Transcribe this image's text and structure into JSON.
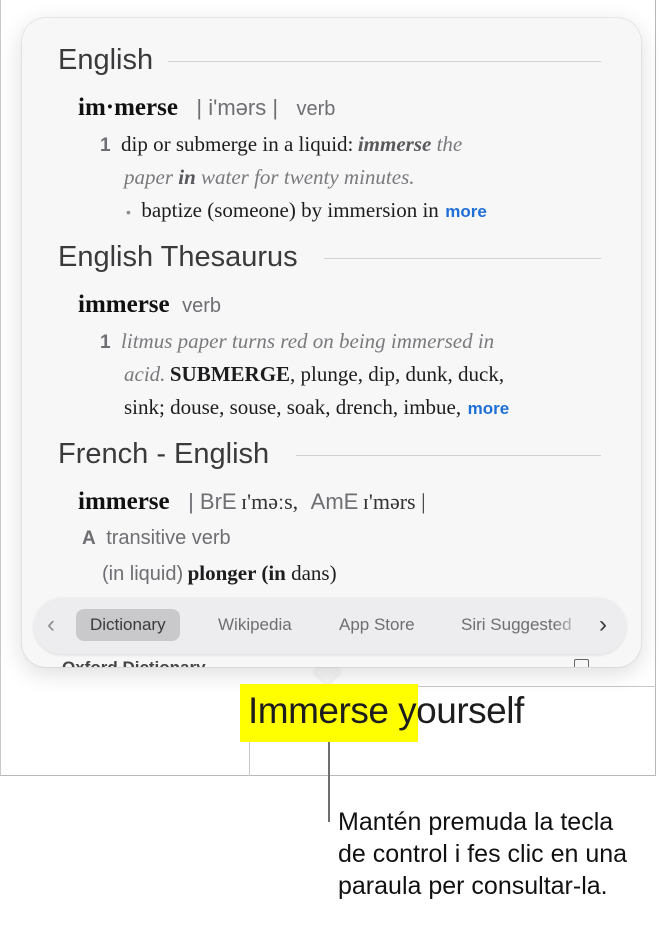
{
  "popover": {
    "sections": [
      {
        "title": "English",
        "headword": "im·merse",
        "pronunciation": "| i'mərs |",
        "part_of_speech": "verb",
        "sense_number": "1",
        "definition": "dip or submerge in a liquid:",
        "example_1a": "immerse",
        "example_1b": " the",
        "example_2a": "paper ",
        "example_2b": "in",
        "example_2c": " water for twenty minutes.",
        "subsense": "baptize (someone) by immersion in",
        "more": "more"
      },
      {
        "title": "English Thesaurus",
        "headword": "immerse",
        "part_of_speech": "verb",
        "sense_number": "1",
        "example_line1": "litmus paper turns red on being immersed in",
        "example_line2": "acid.",
        "synonym_main": "SUBMERGE",
        "synonyms_line1": ", plunge, dip, dunk, duck,",
        "synonyms_line2": "sink; douse, souse, soak, drench, imbue,",
        "more": "more"
      },
      {
        "title": "French - English",
        "headword": "immerse",
        "pron_bre_label": "| BrE",
        "pron_bre": "ɪ'məːs,",
        "pron_ame_label": "AmE",
        "pron_ame": "ɪ'mərs |",
        "grammar_letter": "A",
        "grammar": "transitive verb",
        "context": "(in liquid)",
        "translation_a": "plonger (",
        "translation_b": "in",
        "translation_c": " dans)"
      }
    ],
    "hidden_row": "Oxford Dictionary",
    "tabs": {
      "prev": "‹",
      "next": "›",
      "items": [
        "Dictionary",
        "Wikipedia",
        "App Store",
        "Siri Suggested"
      ],
      "selected": "Dictionary"
    }
  },
  "document": {
    "highlighted_word": "Immerse",
    "rest_text": " yourself"
  },
  "caption": "Mantén premuda la tecla de control i fes clic en una paraula per consultar-la.",
  "colors": {
    "highlight": "#ffff00",
    "link": "#1f6fd6",
    "selected_tab": "#c9c9cc"
  }
}
